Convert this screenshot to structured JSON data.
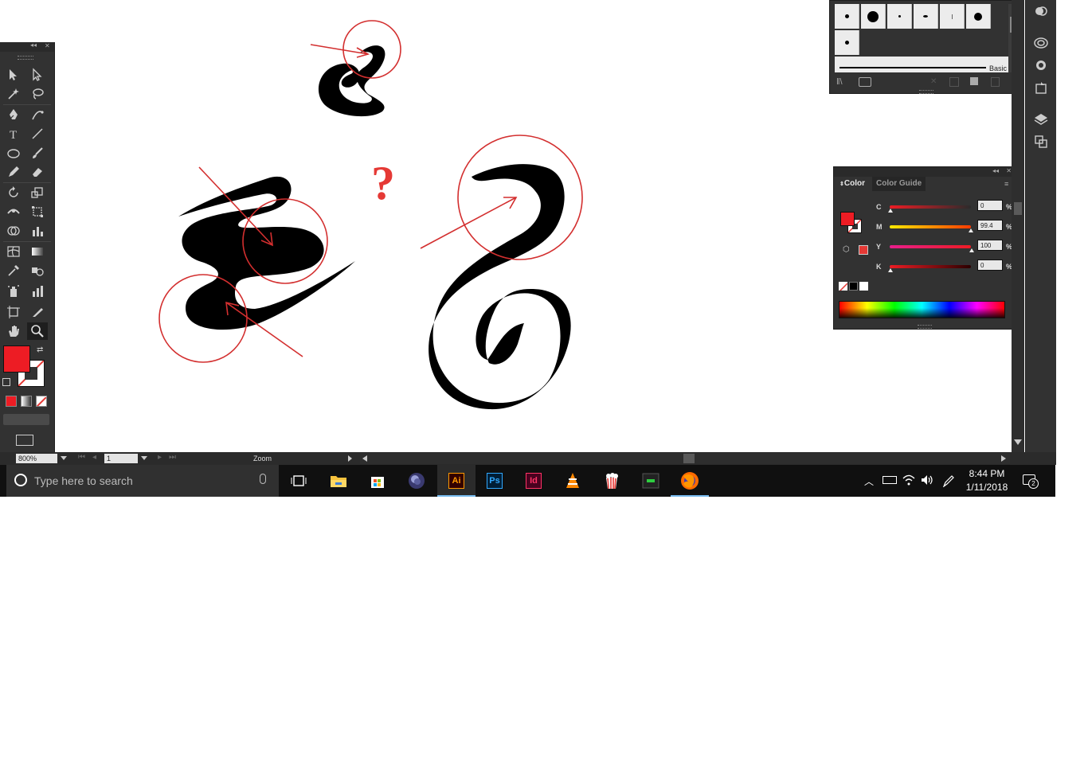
{
  "tools_panel": {
    "collapse_label": "◂◂",
    "close_label": "✕"
  },
  "brushes_panel": {
    "library_name": "Basic"
  },
  "color_panel": {
    "tabs": [
      "Color",
      "Color Guide"
    ],
    "channels": [
      {
        "label": "C",
        "value": "0",
        "unit": "%",
        "level": 0.0
      },
      {
        "label": "M",
        "value": "99.4",
        "unit": "%",
        "level": 0.994
      },
      {
        "label": "Y",
        "value": "100",
        "unit": "%",
        "level": 1.0
      },
      {
        "label": "K",
        "value": "0",
        "unit": "%",
        "level": 0.0
      }
    ],
    "fill_color": "#ed1c24"
  },
  "status_bar": {
    "zoom_value": "800%",
    "artboard_number": "1",
    "tool_status": "Zoom"
  },
  "taskbar": {
    "search_placeholder": "Type here to search",
    "apps": [
      "task-view",
      "file-explorer",
      "store",
      "media",
      "illustrator",
      "photoshop",
      "indesign",
      "vlc",
      "popcorn-time",
      "terminal",
      "firefox"
    ],
    "illustrator_label": "Ai",
    "photoshop_label": "Ps",
    "indesign_label": "Id",
    "time": "8:44 PM",
    "date": "1/11/2018",
    "notification_count": "2"
  },
  "annotation": {
    "question_mark": "?"
  },
  "colors": {
    "accent_red": "#d32f2f",
    "fill_red": "#ed1c24",
    "panel_bg": "#323232"
  }
}
